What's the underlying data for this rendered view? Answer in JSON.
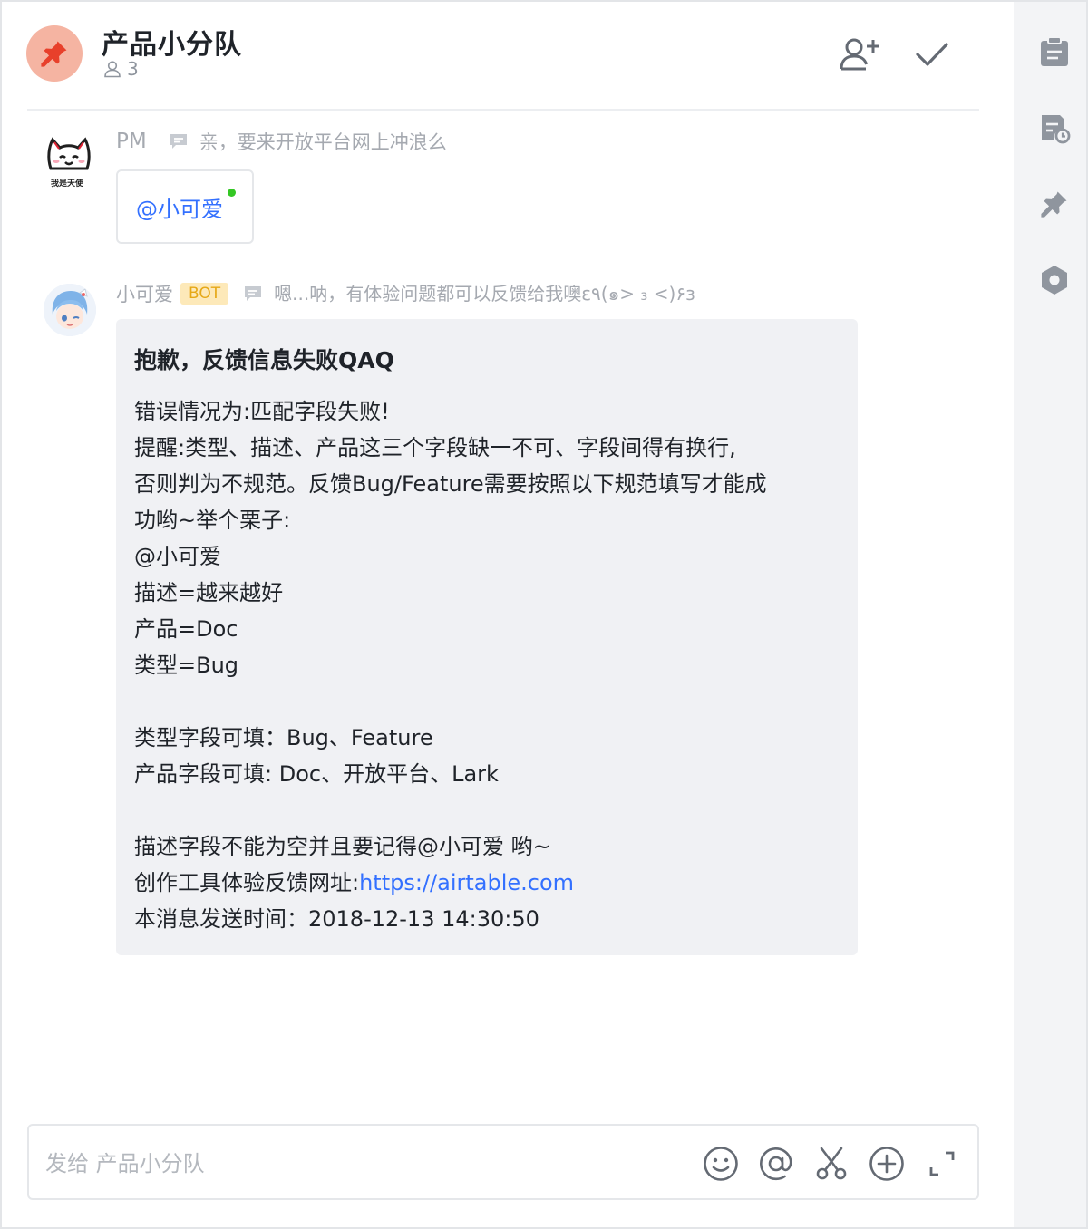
{
  "header": {
    "title": "产品小分队",
    "member_count": "3"
  },
  "messages": [
    {
      "sender": "PM",
      "quote": "亲，要来开放平台网上冲浪么",
      "avatar_caption": "我是天使",
      "mention": "@小可爱"
    },
    {
      "sender": "小可爱",
      "badge": "BOT",
      "quote": "嗯...呐，有体验问题都可以反馈给我噢ε٩(๑> ₃ <)۶з",
      "card": {
        "title": "抱歉，反馈信息失败QAQ",
        "lines": [
          "错误情况为:匹配字段失败!",
          "提醒:类型、描述、产品这三个字段缺一不可、字段间得有换行,",
          "否则判为不规范。反馈Bug/Feature需要按照以下规范填写才能成",
          "功哟~举个栗子:",
          "@小可爱",
          "描述=越来越好",
          "产品=Doc",
          "类型=Bug",
          "",
          "类型字段可填：Bug、Feature",
          "产品字段可填: Doc、开放平台、Lark",
          "",
          "描述字段不能为空并且要记得@小可爱 哟~"
        ],
        "link_prefix": "创作工具体验反馈网址:",
        "link_text": "https://airtable.com",
        "sent_time": "本消息发送时间：2018-12-13 14:30:50"
      }
    }
  ],
  "composer": {
    "placeholder": "发给 产品小分队"
  },
  "icons": {
    "header": [
      "pin-icon",
      "person-icon",
      "add-member-icon",
      "check-icon"
    ],
    "rail": [
      "clipboard-icon",
      "doc-clock-icon",
      "pin-icon",
      "settings-hex-icon"
    ],
    "composer": [
      "emoji-icon",
      "mention-icon",
      "scissors-icon",
      "plus-circle-icon",
      "expand-icon"
    ]
  },
  "colors": {
    "link": "#3370ff",
    "bot_badge_bg": "#fde9b9",
    "bot_badge_text": "#e6a817",
    "online": "#34c724",
    "group_avatar": "#f5b4a2",
    "pin": "#e8402b"
  }
}
